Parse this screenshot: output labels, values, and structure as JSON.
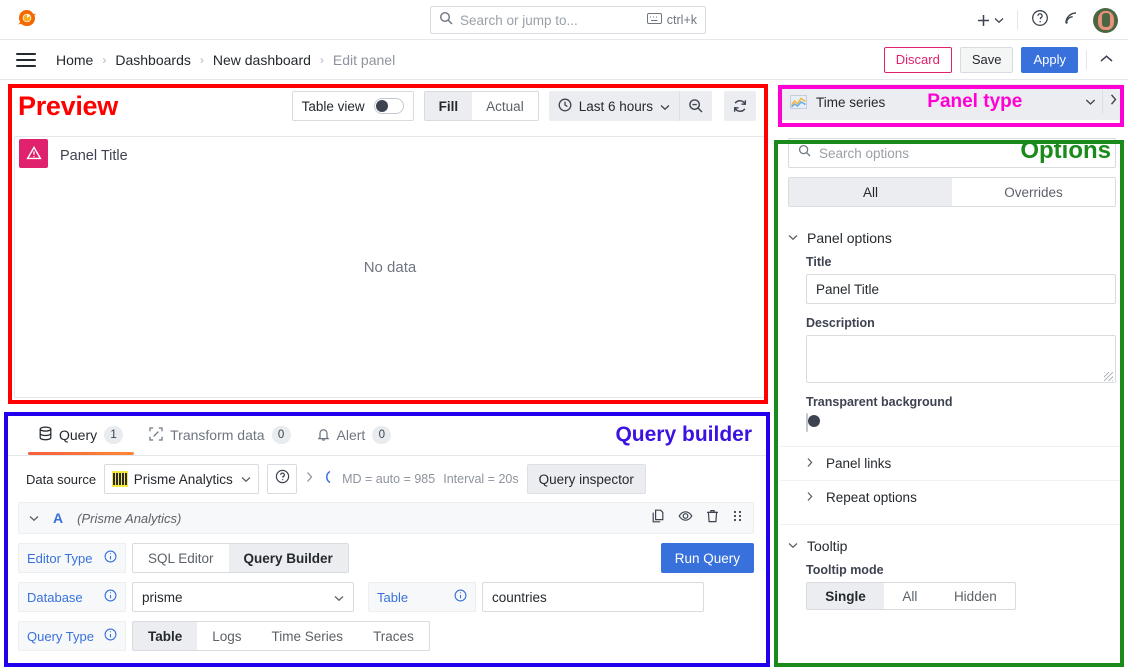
{
  "topnav": {
    "logo_icon": "grafana-logo-icon",
    "search": {
      "placeholder": "Search or jump to...",
      "shortcut": "ctrl+k",
      "icon": "search-icon",
      "kbd_icon": "keyboard-icon"
    },
    "plus_icon": "plus-icon",
    "plus_chevron_icon": "chevron-down-icon",
    "help_icon": "help-circle-icon",
    "news_icon": "rss-feed-icon",
    "avatar": "user-avatar"
  },
  "breadcrumb": {
    "menu_icon": "hamburger-menu-icon",
    "items": [
      "Home",
      "Dashboards",
      "New dashboard",
      "Edit panel"
    ],
    "separator": "›",
    "actions": {
      "discard": "Discard",
      "save": "Save",
      "apply": "Apply",
      "collapse_icon": "chevron-up-icon"
    }
  },
  "annotations": {
    "preview": {
      "text": "Preview",
      "color": "#ff0000"
    },
    "panel_type": {
      "text": "Panel type",
      "color": "#ff00d4"
    },
    "options": {
      "text": "Options",
      "color": "#1a8a1a"
    },
    "query_builder": {
      "text": "Query builder",
      "color": "#3b12e0"
    }
  },
  "preview": {
    "table_view": {
      "label": "Table view",
      "enabled": false
    },
    "fill_actual": {
      "options": [
        "Fill",
        "Actual"
      ],
      "selected": "Fill"
    },
    "time_range": {
      "label": "Last 6 hours",
      "clock_icon": "clock-icon",
      "chevron_icon": "chevron-down-icon"
    },
    "zoom_out_icon": "zoom-out-icon",
    "refresh_icon": "refresh-icon",
    "panel": {
      "title": "Panel Title",
      "error_icon": "warning-triangle-icon",
      "error_color": "#e0226e",
      "body_text": "No data"
    }
  },
  "query_builder": {
    "tabs": [
      {
        "label": "Query",
        "count": "1",
        "icon": "database-icon",
        "active": true
      },
      {
        "label": "Transform data",
        "count": "0",
        "icon": "transform-icon",
        "active": false
      },
      {
        "label": "Alert",
        "count": "0",
        "icon": "bell-icon",
        "active": false
      }
    ],
    "datasource": {
      "label": "Data source",
      "value": "Prisme Analytics",
      "icon": "barcode-icon",
      "chevron_icon": "chevron-down-icon",
      "help_icon": "help-circle-icon",
      "expand_icon": "chevron-right-icon",
      "loading_icon": "spinner-icon",
      "md_text": "MD = auto = 985",
      "interval_text": "Interval = 20s",
      "inspector_button": "Query inspector"
    },
    "query_row": {
      "collapse_icon": "chevron-down-icon",
      "ref_id": "A",
      "datasource_label": "(Prisme Analytics)",
      "copy_icon": "copy-icon",
      "hide_icon": "eye-icon",
      "delete_icon": "trash-icon",
      "drag_icon": "drag-handle-icon"
    },
    "editor_type": {
      "label": "Editor Type",
      "info_icon": "info-circle-icon",
      "options": [
        "SQL Editor",
        "Query Builder"
      ],
      "selected": "Query Builder"
    },
    "run_query_button": "Run Query",
    "database": {
      "label": "Database",
      "info_icon": "info-circle-icon",
      "value": "prisme",
      "chevron_icon": "chevron-down-icon"
    },
    "table": {
      "label": "Table",
      "info_icon": "info-circle-icon",
      "value": "countries"
    },
    "query_type": {
      "label": "Query Type",
      "info_icon": "info-circle-icon",
      "options": [
        "Table",
        "Logs",
        "Time Series",
        "Traces"
      ],
      "selected": "Table"
    }
  },
  "panel_type": {
    "name": "Time series",
    "icon": "time-series-icon",
    "chevron_icon": "chevron-down-icon",
    "expand_icon": "chevron-right-icon"
  },
  "options": {
    "search": {
      "placeholder": "Search options",
      "icon": "search-icon"
    },
    "tabs": {
      "options": [
        "All",
        "Overrides"
      ],
      "selected": "All"
    },
    "panel_options": {
      "section_title": "Panel options",
      "title_label": "Title",
      "title_value": "Panel Title",
      "description_label": "Description",
      "description_value": "",
      "transparent_label": "Transparent background",
      "transparent_enabled": false,
      "panel_links": "Panel links",
      "repeat_options": "Repeat options"
    },
    "tooltip": {
      "section_title": "Tooltip",
      "mode_label": "Tooltip mode",
      "modes": [
        "Single",
        "All",
        "Hidden"
      ],
      "selected": "Single"
    }
  }
}
